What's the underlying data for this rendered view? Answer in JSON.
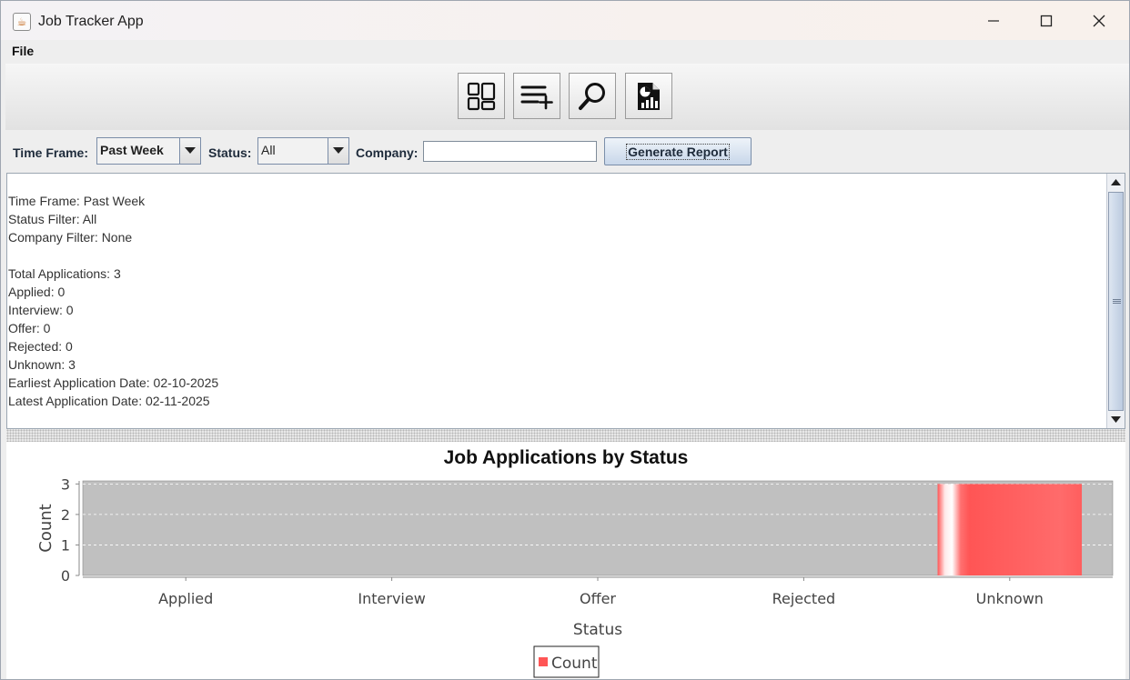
{
  "window": {
    "title": "Job Tracker App",
    "icon": "java-cup-icon",
    "controls": [
      "minimize-icon",
      "maximize-icon",
      "close-icon"
    ]
  },
  "menu": {
    "file_label": "File"
  },
  "toolbar": {
    "buttons": [
      {
        "icon": "dashboard-icon"
      },
      {
        "icon": "add-list-icon"
      },
      {
        "icon": "search-icon"
      },
      {
        "icon": "report-icon"
      }
    ]
  },
  "filters": {
    "time_frame_label": "Time Frame:",
    "time_frame_value": "Past Week",
    "status_label": "Status:",
    "status_value": "All",
    "company_label": "Company:",
    "company_value": "",
    "generate_label": "Generate Report"
  },
  "report": {
    "lines": [
      "Time Frame: Past Week",
      "Status Filter: All",
      "Company Filter: None",
      "",
      "Total Applications: 3",
      "Applied: 0",
      "Interview: 0",
      "Offer: 0",
      "Rejected: 0",
      "Unknown: 3",
      "Earliest Application Date: 02-10-2025",
      "Latest Application Date: 02-11-2025"
    ]
  },
  "chart_data": {
    "type": "bar",
    "title": "Job Applications by Status",
    "xlabel": "Status",
    "ylabel": "Count",
    "categories": [
      "Applied",
      "Interview",
      "Offer",
      "Rejected",
      "Unknown"
    ],
    "series": [
      {
        "name": "Count",
        "values": [
          0,
          0,
          0,
          0,
          3
        ],
        "color": "#ff5555"
      }
    ],
    "ylim": [
      0,
      3.1
    ],
    "yticks": [
      0,
      1,
      2,
      3
    ],
    "grid": true,
    "legend": "bottom",
    "colors": {
      "plot_bg": "#c0c0c0",
      "grid": "#ffffff"
    }
  }
}
